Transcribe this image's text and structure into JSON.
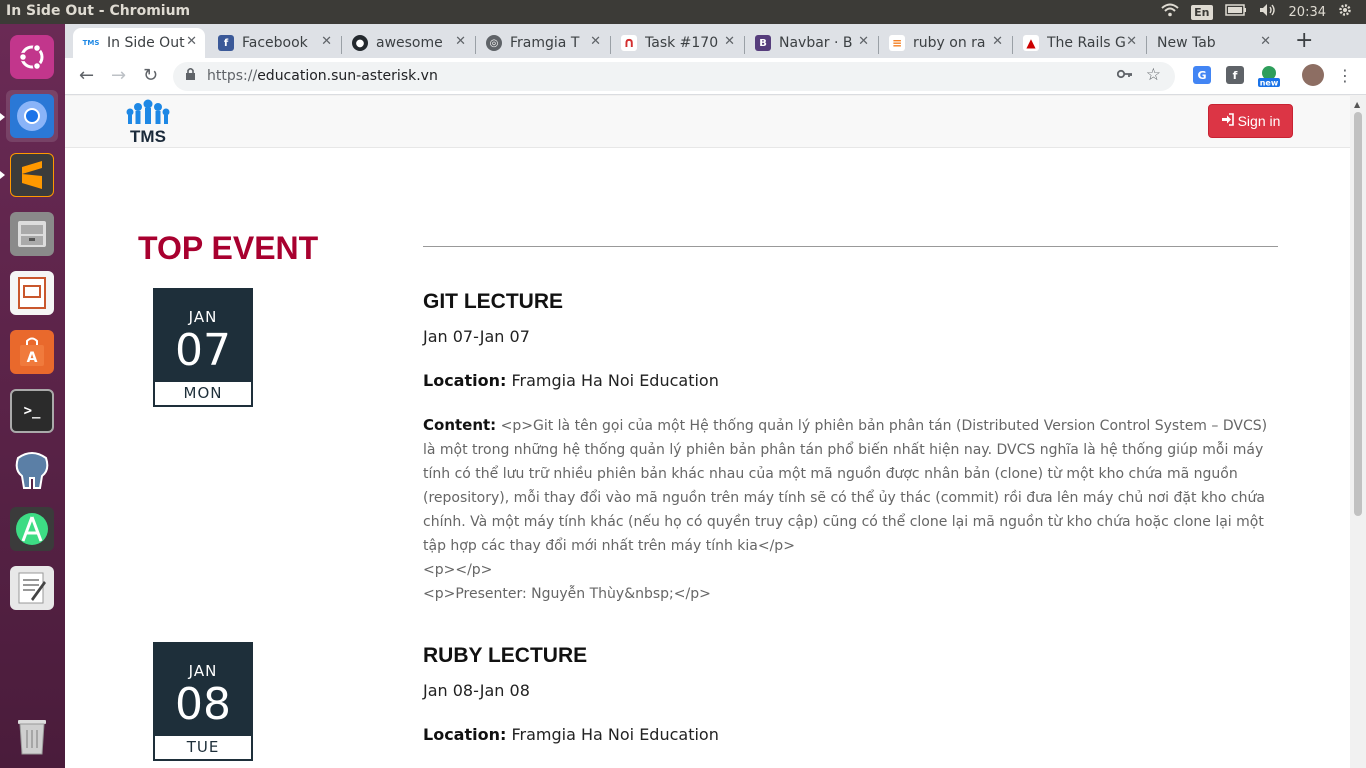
{
  "window": {
    "title": "In Side Out - Chromium"
  },
  "tray": {
    "lang": "En",
    "time": "20:34"
  },
  "tabs": [
    {
      "label": "In Side Out",
      "fav": "TMS",
      "color": "#1e88e5"
    },
    {
      "label": "Facebook",
      "fav": "f",
      "color": "#3b5998"
    },
    {
      "label": "awesome",
      "fav": "●",
      "color": "#24292e"
    },
    {
      "label": "Framgia T",
      "fav": "●",
      "color": "#5f6368"
    },
    {
      "label": "Task #170",
      "fav": "∩",
      "color": "#d32f2f"
    },
    {
      "label": "Navbar · B",
      "fav": "B",
      "color": "#563d7c"
    },
    {
      "label": "ruby on ra",
      "fav": "≡",
      "color": "#f48024"
    },
    {
      "label": "The Rails G",
      "fav": "▲",
      "color": "#cc0000"
    },
    {
      "label": "New Tab",
      "fav": "",
      "color": ""
    }
  ],
  "toolbar": {
    "url_scheme": "https://",
    "url_host": "education.sun-asterisk.vn"
  },
  "extensions": {
    "new_badge": "new"
  },
  "site": {
    "signin_label": "Sign in",
    "section_title": "TOP EVENT"
  },
  "events": [
    {
      "month": "JAN",
      "day": "07",
      "weekday": "MON",
      "title": "GIT LECTURE",
      "date_range": "Jan 07-Jan 07",
      "location_label": "Location:",
      "location": "Framgia Ha Noi Education",
      "content_label": "Content:",
      "content": "<p>Git là tên gọi của một Hệ thống quản lý phiên bản phân tán (Distributed Version Control System – DVCS) là một trong những hệ thống quản lý phiên bản phân tán phổ biến nhất hiện nay. DVCS nghĩa là hệ thống giúp mỗi máy tính có thể lưu trữ nhiều phiên bản khác nhau của một mã nguồn được nhân bản (clone) từ một kho chứa mã nguồn (repository), mỗi thay đổi vào mã nguồn trên máy tính sẽ có thể ủy thác (commit) rồi đưa lên máy chủ nơi đặt kho chứa chính. Và một máy tính khác (nếu họ có quyền truy cập) cũng có thể clone lại mã nguồn từ kho chứa hoặc clone lại một tập hợp các thay đổi mới nhất trên máy tính kia</p>",
      "content_line2": "<p></p>",
      "content_line3": "<p>Presenter: Nguyễn Thùy&nbsp;</p>"
    },
    {
      "month": "JAN",
      "day": "08",
      "weekday": "TUE",
      "title": "RUBY LECTURE",
      "date_range": "Jan 08-Jan 08",
      "location_label": "Location:",
      "location": "Framgia Ha Noi Education"
    }
  ],
  "launcher": [
    {
      "name": "ubuntu-dash",
      "color": "#c2368c"
    },
    {
      "name": "chromium",
      "color": "#1e6fd9"
    },
    {
      "name": "sublime-text",
      "color": "#3b3b3b"
    },
    {
      "name": "files",
      "color": "#7a7a7a"
    },
    {
      "name": "impress",
      "color": "#c9572d"
    },
    {
      "name": "software-center",
      "color": "#e9692c"
    },
    {
      "name": "terminal",
      "color": "#2b2b2b"
    },
    {
      "name": "pgadmin",
      "color": "#336791"
    },
    {
      "name": "android-studio",
      "color": "#3ddc84"
    },
    {
      "name": "text-editor",
      "color": "#e8e8e8"
    },
    {
      "name": "trash",
      "color": "#cfcfcf"
    }
  ]
}
